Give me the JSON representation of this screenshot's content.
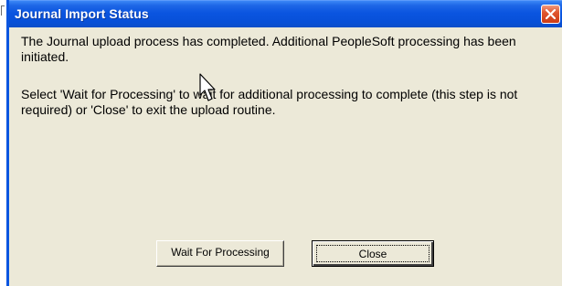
{
  "window": {
    "title": "Journal Import Status",
    "close_icon": "close-x-icon"
  },
  "message": {
    "line1": "The Journal upload process has completed.  Additional PeopleSoft processing has been initiated.",
    "line2": "Select 'Wait for Processing' to wait for additional processing to complete (this step is not required) or 'Close' to exit the upload routine."
  },
  "buttons": {
    "wait_label": "Wait For Processing",
    "close_label": "Close",
    "default_button": "Close"
  },
  "colors": {
    "titlebar": "#0a55e0",
    "dialog_bg": "#ece9d8",
    "close_button": "#e0562f"
  }
}
